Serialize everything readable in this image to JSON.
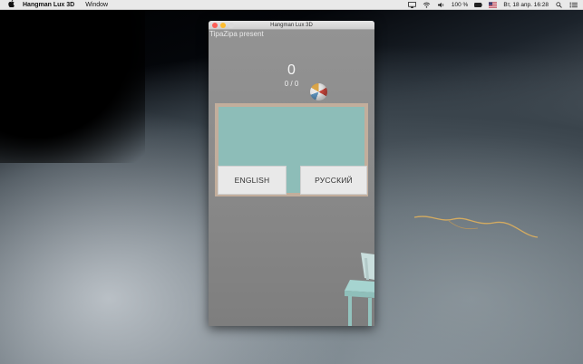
{
  "menubar": {
    "apple_symbol": "",
    "app_name": "Hangman Lux 3D",
    "menus": [
      "Window"
    ],
    "battery": "100 %",
    "input_source": "RU",
    "datetime": "Вт, 18 апр.  16:28"
  },
  "window": {
    "title": "Hangman Lux 3D"
  },
  "game": {
    "presenter": "TipaZipa present",
    "score": "0",
    "progress": "0 / 0",
    "buttons": {
      "english": "ENGLISH",
      "russian": "РУССКИЙ"
    }
  },
  "icons": [
    "apple-icon",
    "airplay-icon",
    "wifi-icon",
    "volume-icon",
    "battery-icon",
    "flag-icon",
    "search-icon",
    "menu-list-icon"
  ]
}
